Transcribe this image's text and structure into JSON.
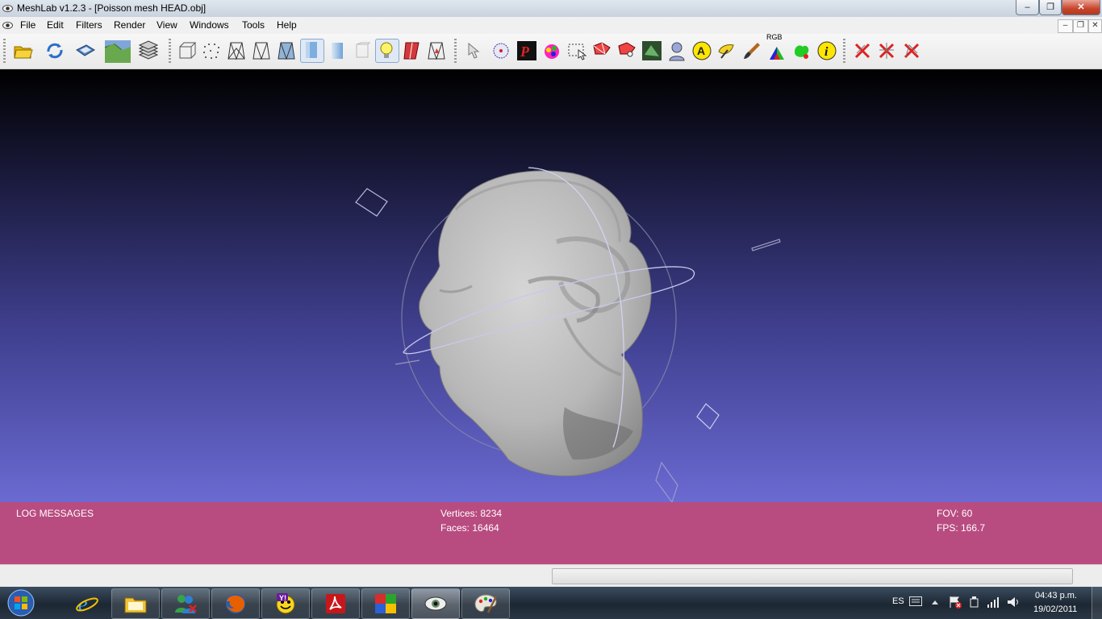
{
  "window": {
    "title": "MeshLab v1.2.3 - [Poisson mesh HEAD.obj]",
    "minimize_glyph": "–",
    "restore_glyph": "❐",
    "close_glyph": "✕"
  },
  "menu": {
    "items": [
      "File",
      "Edit",
      "Filters",
      "Render",
      "View",
      "Windows",
      "Tools",
      "Help"
    ],
    "mdi_minimize": "–",
    "mdi_restore": "❐",
    "mdi_close": "✕"
  },
  "toolbar": {
    "buttons": [
      {
        "name": "open-icon"
      },
      {
        "name": "reload-icon"
      },
      {
        "name": "save-icon"
      },
      {
        "name": "snapshot-icon"
      },
      {
        "name": "layers-icon"
      },
      {
        "name": "bbox-icon"
      },
      {
        "name": "points-icon"
      },
      {
        "name": "wireframe-icon"
      },
      {
        "name": "hidden-lines-icon"
      },
      {
        "name": "flat-lines-icon"
      },
      {
        "name": "flat-icon",
        "pressed": true
      },
      {
        "name": "smooth-icon"
      },
      {
        "name": "texture-icon"
      },
      {
        "name": "light-icon",
        "pressed": true
      },
      {
        "name": "backface-icon"
      },
      {
        "name": "selected-faces-icon"
      },
      {
        "name": "manipulator-icon"
      },
      {
        "name": "measure-icon"
      },
      {
        "name": "pickpoints-icon"
      },
      {
        "name": "paint-icon"
      },
      {
        "name": "select-faces-icon"
      },
      {
        "name": "select-vertices-icon"
      },
      {
        "name": "select-connected-icon"
      },
      {
        "name": "align-icon"
      },
      {
        "name": "qualitymapper-icon"
      },
      {
        "name": "annotation-icon"
      },
      {
        "name": "mutual-info-icon"
      },
      {
        "name": "brush-icon"
      },
      {
        "name": "rgb-icon"
      },
      {
        "name": "segment-icon"
      },
      {
        "name": "info-icon"
      },
      {
        "name": "delete-faces-icon"
      },
      {
        "name": "delete-vertices-icon"
      },
      {
        "name": "delete-selected-icon"
      }
    ],
    "rgb_label": "RGB"
  },
  "info": {
    "log_label": "LOG MESSAGES",
    "vertices": "Vertices: 8234",
    "faces": "Faces: 16464",
    "fov": "FOV: 60",
    "fps": "FPS:   166.7"
  },
  "taskbar": {
    "apps": [
      "internet-explorer",
      "file-explorer",
      "messenger",
      "firefox",
      "yahoo-messenger",
      "acrobat",
      "windows-media-center",
      "meshlab",
      "paint"
    ],
    "language": "ES",
    "time": "04:43 p.m.",
    "date": "19/02/2011"
  },
  "colors": {
    "info_panel": "#b84c80",
    "viewport_top": "#000000",
    "viewport_bottom": "#6a6ad2"
  }
}
